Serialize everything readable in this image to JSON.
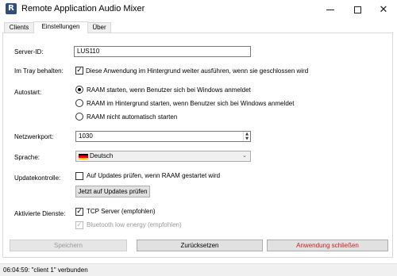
{
  "window": {
    "title": "Remote Application Audio Mixer",
    "icon_letter": "R"
  },
  "tabs": [
    {
      "label": "Clients"
    },
    {
      "label": "Einstellungen"
    },
    {
      "label": "Über"
    }
  ],
  "settings": {
    "server_id": {
      "label": "Server-ID:",
      "value": "LUS110"
    },
    "tray": {
      "label": "Im Tray behalten:",
      "checkbox_label": "Diese Anwendung im Hintergrund weiter ausführen, wenn sie geschlossen wird",
      "checked": true
    },
    "autostart": {
      "label": "Autostart:",
      "options": [
        {
          "label": "RAAM starten, wenn Benutzer sich bei Windows anmeldet",
          "selected": true
        },
        {
          "label": "RAAM im Hintergrund starten, wenn Benutzer sich bei Windows anmeldet",
          "selected": false
        },
        {
          "label": "RAAM nicht automatisch starten",
          "selected": false
        }
      ]
    },
    "port": {
      "label": "Netzwerkport:",
      "value": "1030"
    },
    "language": {
      "label": "Sprache:",
      "value": "Deutsch"
    },
    "updates": {
      "label": "Updatekontrolle:",
      "checkbox_label": "Auf Updates prüfen, wenn RAAM gestartet wird",
      "checked": false,
      "button_label": "Jetzt auf Updates prüfen"
    },
    "services": {
      "label": "Aktivierte Dienste:",
      "tcp": {
        "label": "TCP Server (empfohlen)",
        "checked": true
      },
      "ble": {
        "label": "Bluetooth low energy (empfohlen)",
        "checked": true,
        "disabled": true
      }
    }
  },
  "actions": {
    "save": "Speichern",
    "reset": "Zurücksetzen",
    "close_app": "Anwendung schließen"
  },
  "status": {
    "text": "06:04:59: \"client 1\" verbunden"
  },
  "colors": {
    "danger": "#e0181c",
    "radio_dot": "#000000"
  }
}
